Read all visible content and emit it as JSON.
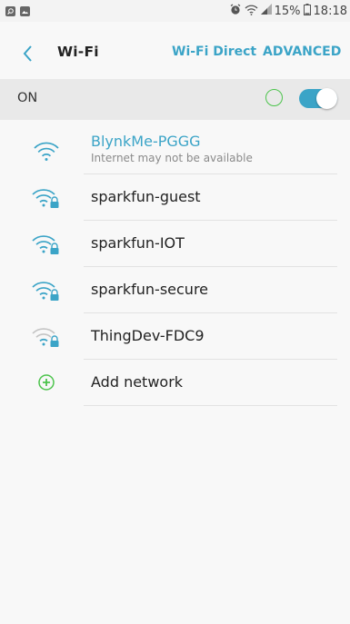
{
  "status_bar": {
    "battery": "15%",
    "time": "18:18",
    "icons": [
      "search-icon",
      "image-icon",
      "alarm-icon",
      "wifi-icon",
      "signal-icon",
      "battery-icon"
    ]
  },
  "header": {
    "title": "Wi-Fi",
    "wifi_direct": "Wi-Fi Direct",
    "advanced": "ADVANCED"
  },
  "wifi_switch": {
    "label": "ON",
    "state": "on"
  },
  "networks": [
    {
      "ssid": "BlynkMe-PGGG",
      "status": "Internet may not be available",
      "secured": false,
      "connected": true,
      "signal": "full"
    },
    {
      "ssid": "sparkfun-guest",
      "secured": true,
      "connected": false,
      "signal": "full"
    },
    {
      "ssid": "sparkfun-IOT",
      "secured": true,
      "connected": false,
      "signal": "full"
    },
    {
      "ssid": "sparkfun-secure",
      "secured": true,
      "connected": false,
      "signal": "full"
    },
    {
      "ssid": "ThingDev-FDC9",
      "secured": true,
      "connected": false,
      "signal": "weak"
    }
  ],
  "add_network": {
    "label": "Add network"
  },
  "colors": {
    "accent": "#3ba4c7",
    "green": "#4cc44c",
    "weak_signal": "#c4c4c4"
  }
}
